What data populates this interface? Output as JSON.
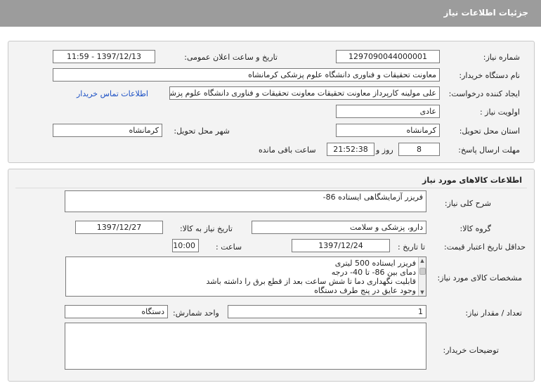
{
  "header": {
    "title": "جزئيات اطلاعات نياز"
  },
  "need_info": {
    "need_number_label": "شماره نياز:",
    "need_number": "1297090044000001",
    "announce_label": "تاريخ و ساعت اعلان عمومی:",
    "announce_value": "1397/12/13 - 11:59",
    "buyer_org_label": "نام دستگاه خريدار:",
    "buyer_org": "معاونت تحقيقات و فناوری دانشگاه علوم پزشکی کرمانشاه",
    "requester_label": "ايجاد کننده درخواست:",
    "requester": "علی مولينه کارپرداز معاونت تحقيقات معاونت تحقيقات و فناوری دانشگاه علوم پزشکی کرمانشاه",
    "contact_link": "اطلاعات تماس خريدار",
    "priority_label": "اولويت نياز :",
    "priority": "عادی",
    "province_label": "استان محل تحويل:",
    "province": "کرمانشاه",
    "city_label": "شهر محل تحويل:",
    "city": "کرمانشاه",
    "deadline_label": "مهلت ارسال پاسخ:",
    "deadline_days": "8",
    "days_word": "روز و",
    "deadline_time": "21:52:38",
    "remaining_word": "ساعت باقی مانده"
  },
  "goods": {
    "section_title": "اطلاعات کالاهای مورد نياز",
    "general_desc_label": "شرح کلی نياز:",
    "general_desc": "فريزر آزمايشگاهی ايستاده 86-",
    "group_label": "گروه کالا:",
    "group": "دارو، پزشکی و سلامت",
    "need_date_label": "تاريخ نياز به کالا:",
    "need_date": "1397/12/27",
    "validity_label": "حداقل تاريخ اعتبار قيمت:",
    "to_date_label": "تا تاريخ :",
    "to_date": "1397/12/24",
    "time_label": "ساعت :",
    "time": "10:00",
    "specs_label": "مشخصات کالای مورد نياز:",
    "specs_lines": [
      "فريزر ايستاده 500 ليتری",
      "دمای بين 86- تا 40- درجه",
      "قابليت نگهداری دما تا شش ساعت بعد از قطع برق را داشته باشد",
      "وجود عايق در پنج طرف دستگاه"
    ],
    "quantity_label": "تعداد / مقدار نياز:",
    "quantity": "1",
    "unit_label": "واحد شمارش:",
    "unit": "دستگاه",
    "buyer_notes_label": "توضيحات خريدار:",
    "buyer_notes": ""
  },
  "icons": {
    "scroll_up": "triangle-up",
    "scroll_down": "triangle-down"
  }
}
